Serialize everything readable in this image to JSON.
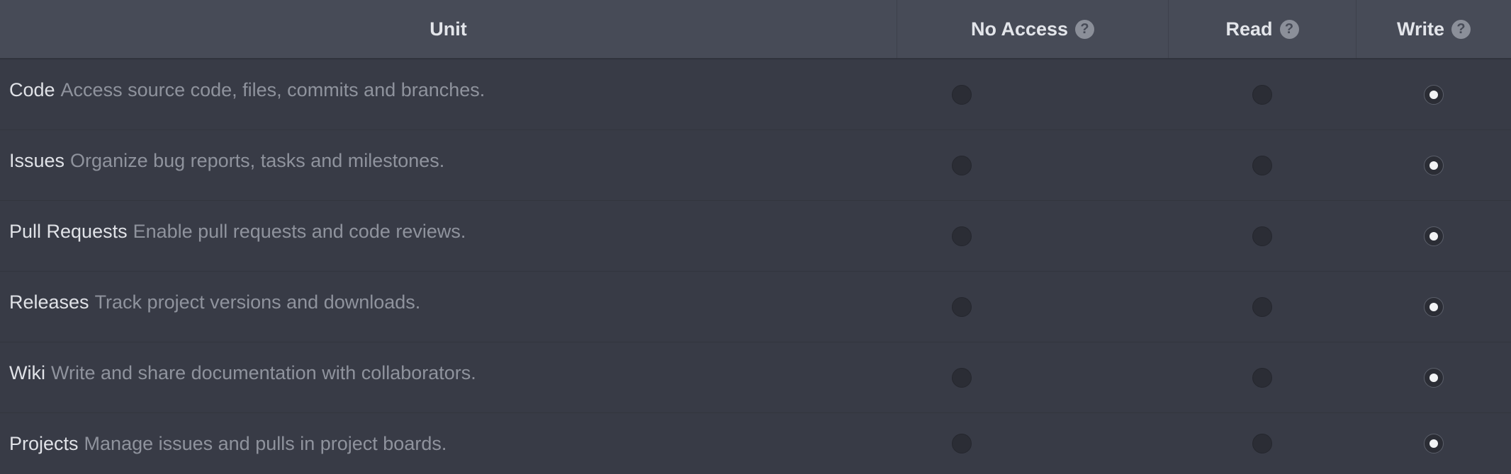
{
  "header": {
    "unit": "Unit",
    "no_access": "No Access",
    "read": "Read",
    "write": "Write",
    "help_icon": "question-circle-icon"
  },
  "units": [
    {
      "name": "Code",
      "description": "Access source code, files, commits and branches.",
      "selected": "write"
    },
    {
      "name": "Issues",
      "description": "Organize bug reports, tasks and milestones.",
      "selected": "write"
    },
    {
      "name": "Pull Requests",
      "description": "Enable pull requests and code reviews.",
      "selected": "write"
    },
    {
      "name": "Releases",
      "description": "Track project versions and downloads.",
      "selected": "write"
    },
    {
      "name": "Wiki",
      "description": "Write and share documentation with collaborators.",
      "selected": "write"
    },
    {
      "name": "Projects",
      "description": "Manage issues and pulls in project boards.",
      "selected": "write"
    }
  ],
  "colors": {
    "background": "#383b46",
    "header_bg": "#474b57",
    "text_primary": "#e0e2e7",
    "text_secondary": "#8f939d"
  }
}
